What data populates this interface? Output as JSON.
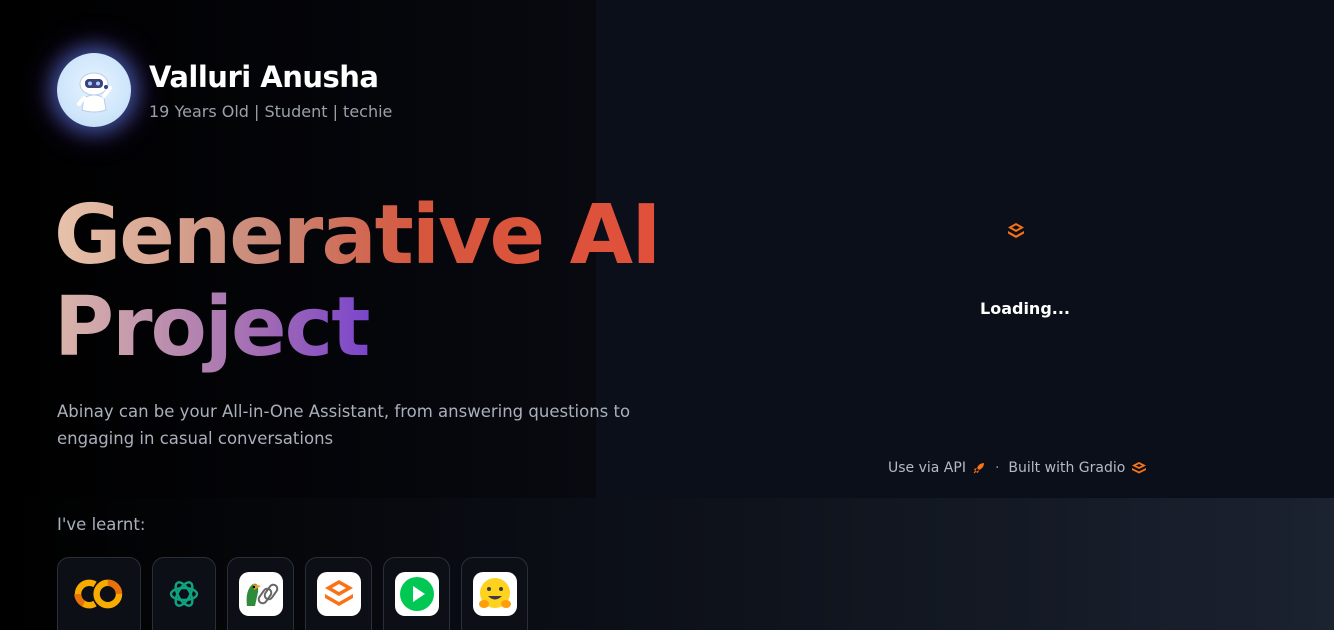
{
  "profile": {
    "name": "Valluri Anusha",
    "tagline": "19 Years Old | Student | techie",
    "avatar_icon": "robot-avatar-icon"
  },
  "hero": {
    "line1": "Generative AI",
    "line2": "Project"
  },
  "description": "Abinay can be your All-in-One Assistant, from answering questions to engaging in casual conversations",
  "learnt": {
    "label": "I've learnt:",
    "tools": [
      {
        "icon": "google-colab-icon"
      },
      {
        "icon": "openai-icon"
      },
      {
        "icon": "langchain-icon"
      },
      {
        "icon": "gradio-icon"
      },
      {
        "icon": "play-button-icon"
      },
      {
        "icon": "hugging-face-icon"
      }
    ]
  },
  "app_panel": {
    "status": "Loading...",
    "api_link": "Use via API",
    "built_with": "Built with Gradio",
    "separator": "·"
  },
  "colors": {
    "gradio_orange": "#f97316",
    "colab_orange": "#f9ab00",
    "openai_green": "#10a37f",
    "play_green": "#00c853"
  }
}
